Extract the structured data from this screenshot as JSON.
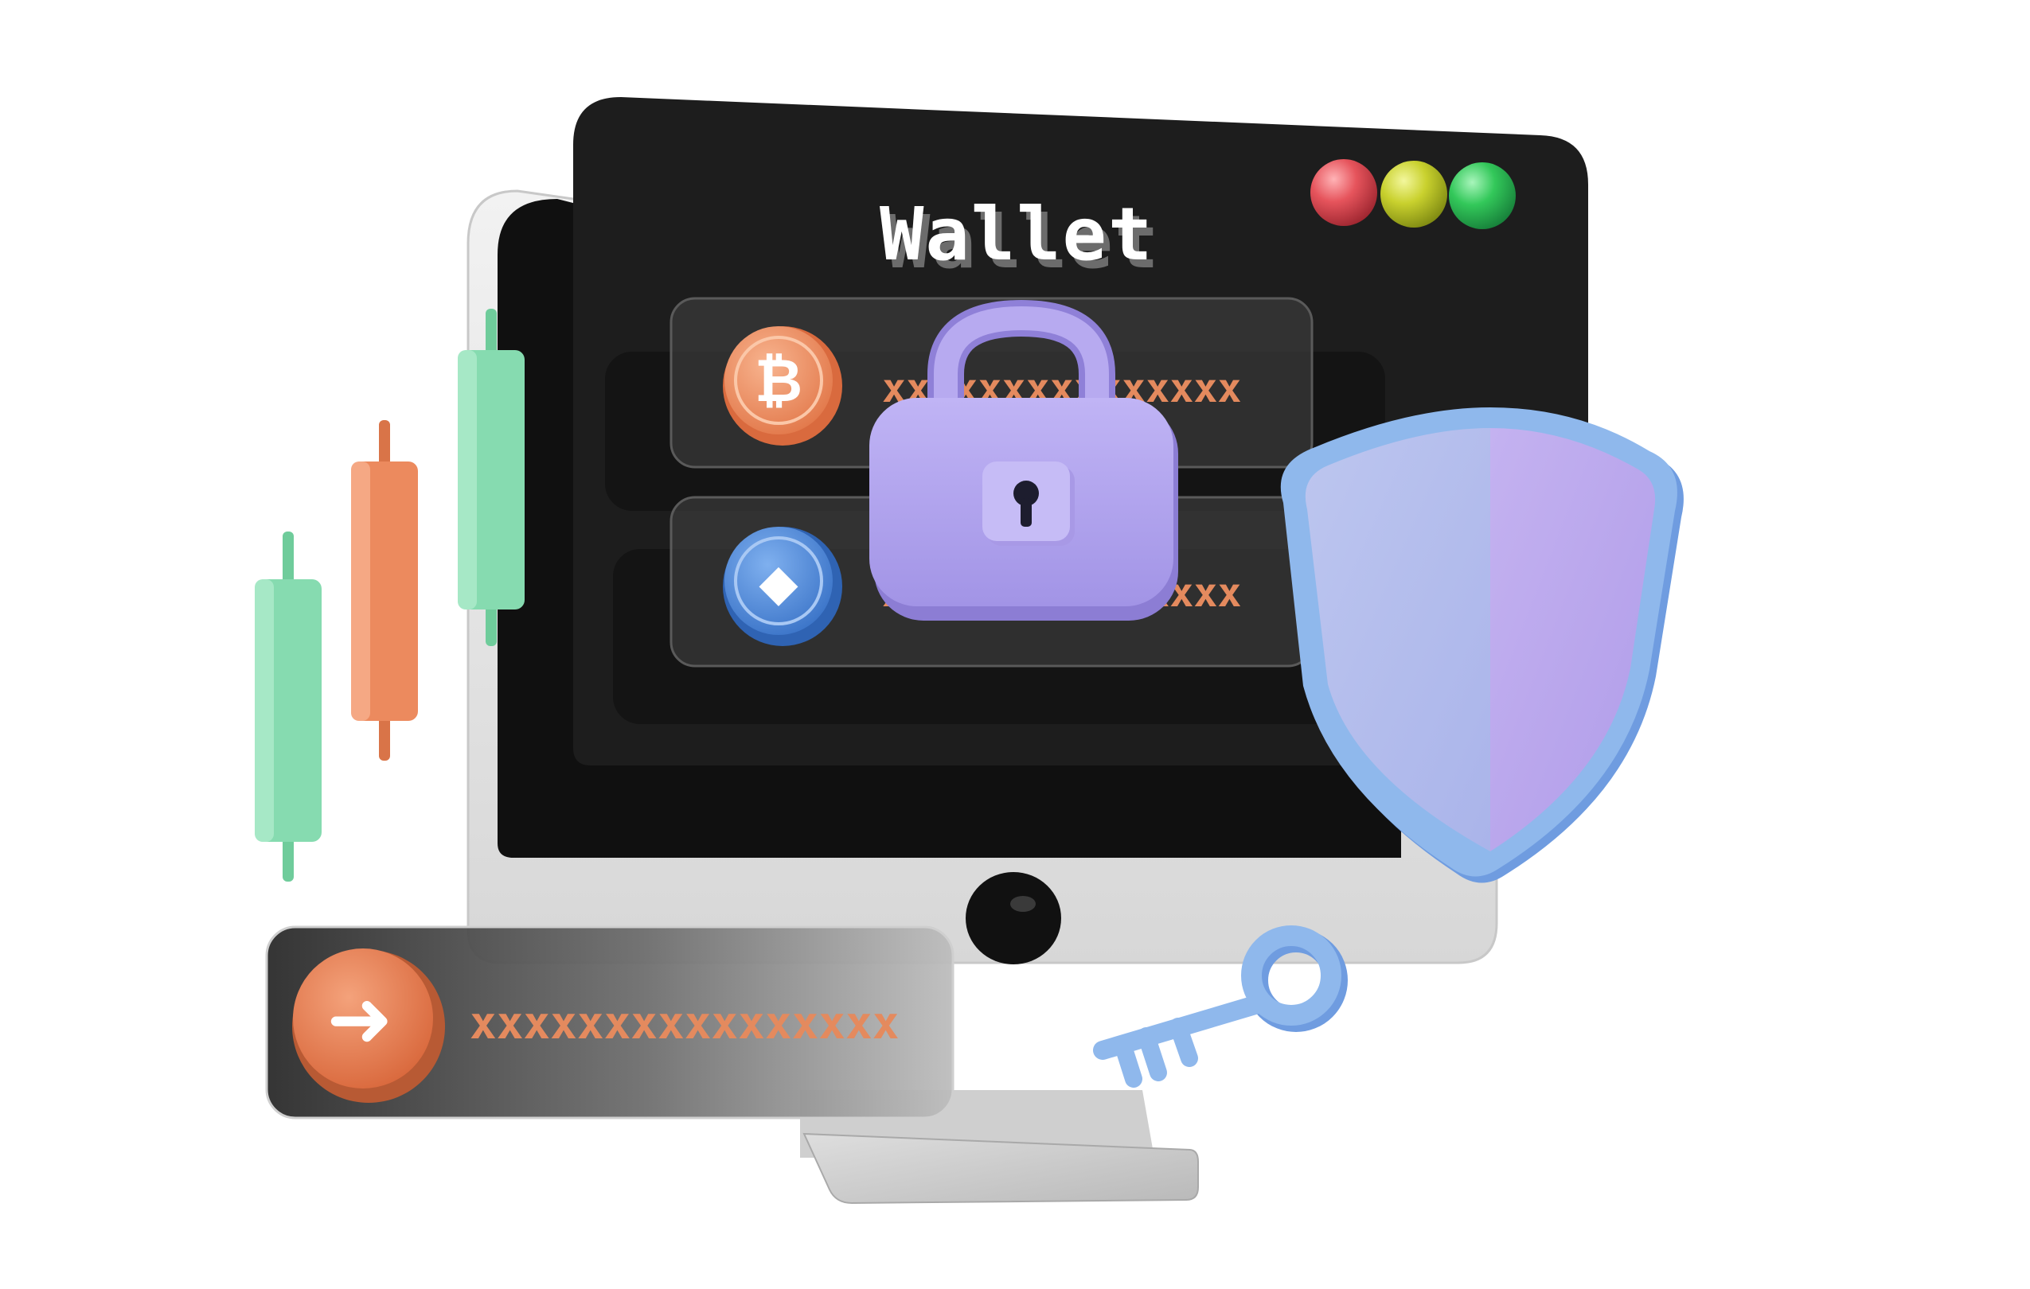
{
  "wallet": {
    "title": "Wallet",
    "window_buttons": [
      {
        "name": "close",
        "color": "#e6545c"
      },
      {
        "name": "minimize",
        "color": "#c9d12e"
      },
      {
        "name": "maximize",
        "color": "#33c85a"
      }
    ],
    "assets": [
      {
        "name": "bitcoin",
        "icon": "bitcoin-coin-icon",
        "glyph": "₿",
        "color": "#f0905f",
        "masked_value": "xxxxxxxxxxxxxxx"
      },
      {
        "name": "ethereum",
        "icon": "ethereum-coin-icon",
        "glyph": "◆",
        "color": "#4a86d8",
        "masked_value": "xxxxxxxxxxxxxxx"
      }
    ]
  },
  "transfer_bar": {
    "icon": "arrow-right-icon",
    "glyph": "➜",
    "masked_value": "xxxxxxxxxxxxxxxx"
  },
  "candles": [
    {
      "color": "#86dbb0",
      "direction": "up"
    },
    {
      "color": "#ec8a5e",
      "direction": "down"
    },
    {
      "color": "#86dbb0",
      "direction": "up"
    }
  ],
  "security": {
    "lock_icon": "padlock-icon",
    "shield_icon": "shield-icon",
    "key_icon": "key-icon"
  },
  "colors": {
    "screen": "#1b1b1b",
    "monitor_frame": "#e6e6e6",
    "accent_orange": "#ec8a5e",
    "accent_green": "#86dbb0",
    "lock_purple": "#b4a6ef",
    "shield_border": "#8fb8ec",
    "key_blue": "#8fb8ec"
  }
}
